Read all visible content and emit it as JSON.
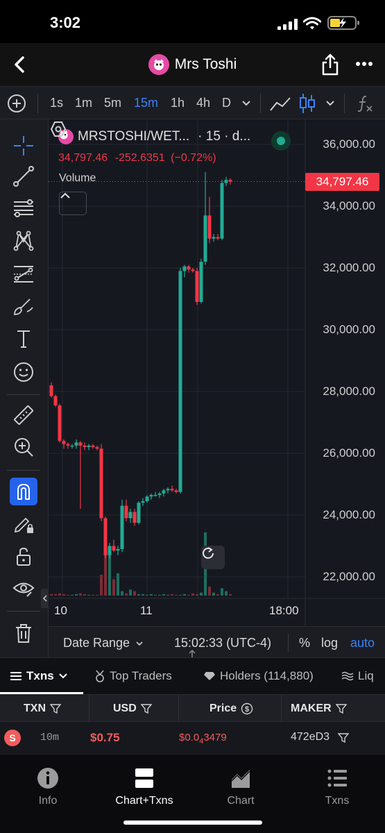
{
  "status_bar": {
    "time": "3:02"
  },
  "header": {
    "title": "Mrs Toshi"
  },
  "toolbar": {
    "timeframes": [
      {
        "label": "1s",
        "active": false
      },
      {
        "label": "1m",
        "active": false
      },
      {
        "label": "5m",
        "active": false
      },
      {
        "label": "15m",
        "active": true
      },
      {
        "label": "1h",
        "active": false
      },
      {
        "label": "4h",
        "active": false
      },
      {
        "label": "D",
        "active": false
      }
    ]
  },
  "legend": {
    "symbol": "MRSTOSHI/WET...",
    "interval": "· 15 · d...",
    "last": "34,797.46",
    "change": "-252.6351",
    "change_pct": "(−0.72%)",
    "volume_label": "Volume"
  },
  "chart_data": {
    "type": "candlestick",
    "y_range": [
      21000,
      36500
    ],
    "y_ticks": [
      "36,000.00",
      "34,000.00",
      "32,000.00",
      "30,000.00",
      "28,000.00",
      "26,000.00",
      "24,000.00",
      "22,000.00"
    ],
    "y_tick_values": [
      36000,
      34000,
      32000,
      30000,
      28000,
      26000,
      24000,
      22000
    ],
    "last_price": "34,797.46",
    "last_price_value": 34797.46,
    "x_ticks": [
      "10",
      "11",
      "18:00"
    ],
    "candles": [
      {
        "o": 28200,
        "h": 28300,
        "l": 27800,
        "c": 27850
      },
      {
        "o": 27850,
        "h": 27900,
        "l": 27500,
        "c": 27550
      },
      {
        "o": 27550,
        "h": 27600,
        "l": 26350,
        "c": 26400
      },
      {
        "o": 26400,
        "h": 26450,
        "l": 26150,
        "c": 26300
      },
      {
        "o": 26300,
        "h": 26350,
        "l": 26150,
        "c": 26250
      },
      {
        "o": 26250,
        "h": 26300,
        "l": 26150,
        "c": 26250
      },
      {
        "o": 26250,
        "h": 26450,
        "l": 26150,
        "c": 26350
      },
      {
        "o": 26350,
        "h": 26400,
        "l": 24200,
        "c": 26250
      },
      {
        "o": 26250,
        "h": 26350,
        "l": 26100,
        "c": 26200
      },
      {
        "o": 26200,
        "h": 26300,
        "l": 26100,
        "c": 26250
      },
      {
        "o": 26250,
        "h": 26300,
        "l": 26150,
        "c": 26200
      },
      {
        "o": 26200,
        "h": 26250,
        "l": 26100,
        "c": 26150
      },
      {
        "o": 26150,
        "h": 26300,
        "l": 23800,
        "c": 23900
      },
      {
        "o": 23900,
        "h": 23950,
        "l": 22600,
        "c": 22700
      },
      {
        "o": 22700,
        "h": 23100,
        "l": 22600,
        "c": 23000
      },
      {
        "o": 23000,
        "h": 23200,
        "l": 22800,
        "c": 22850
      },
      {
        "o": 22850,
        "h": 23000,
        "l": 22700,
        "c": 22900
      },
      {
        "o": 22900,
        "h": 24500,
        "l": 22800,
        "c": 24300
      },
      {
        "o": 24300,
        "h": 24500,
        "l": 23800,
        "c": 23900
      },
      {
        "o": 23900,
        "h": 24200,
        "l": 23750,
        "c": 24100
      },
      {
        "o": 24100,
        "h": 24200,
        "l": 23650,
        "c": 23750
      },
      {
        "o": 23750,
        "h": 24450,
        "l": 23700,
        "c": 24400
      },
      {
        "o": 24400,
        "h": 24550,
        "l": 24300,
        "c": 24450
      },
      {
        "o": 24450,
        "h": 24650,
        "l": 24400,
        "c": 24600
      },
      {
        "o": 24600,
        "h": 24700,
        "l": 24500,
        "c": 24650
      },
      {
        "o": 24650,
        "h": 24750,
        "l": 24600,
        "c": 24650
      },
      {
        "o": 24650,
        "h": 24750,
        "l": 24550,
        "c": 24700
      },
      {
        "o": 24700,
        "h": 24850,
        "l": 24600,
        "c": 24800
      },
      {
        "o": 24800,
        "h": 24900,
        "l": 24700,
        "c": 24850
      },
      {
        "o": 24850,
        "h": 24950,
        "l": 24750,
        "c": 24800
      },
      {
        "o": 24800,
        "h": 24850,
        "l": 24700,
        "c": 24750
      },
      {
        "o": 24750,
        "h": 32000,
        "l": 24700,
        "c": 31900
      },
      {
        "o": 31900,
        "h": 32100,
        "l": 31700,
        "c": 32050
      },
      {
        "o": 32050,
        "h": 32100,
        "l": 31850,
        "c": 31950
      },
      {
        "o": 31950,
        "h": 32000,
        "l": 31850,
        "c": 31900
      },
      {
        "o": 31900,
        "h": 32000,
        "l": 30800,
        "c": 30900
      },
      {
        "o": 30900,
        "h": 32300,
        "l": 30850,
        "c": 32200
      },
      {
        "o": 32200,
        "h": 35100,
        "l": 32100,
        "c": 33700
      },
      {
        "o": 33700,
        "h": 34300,
        "l": 32800,
        "c": 32950
      },
      {
        "o": 32950,
        "h": 33100,
        "l": 32850,
        "c": 33000
      },
      {
        "o": 33000,
        "h": 33100,
        "l": 32900,
        "c": 32950
      },
      {
        "o": 32950,
        "h": 34850,
        "l": 32900,
        "c": 34750
      },
      {
        "o": 34750,
        "h": 34950,
        "l": 34650,
        "c": 34850
      },
      {
        "o": 34850,
        "h": 34900,
        "l": 34700,
        "c": 34797
      }
    ],
    "volume": [
      2,
      2,
      3,
      2,
      1,
      1,
      2,
      3,
      2,
      1,
      1,
      1,
      28,
      55,
      65,
      22,
      30,
      6,
      3,
      8,
      6,
      2,
      2,
      1,
      2,
      1,
      1,
      2,
      1,
      2,
      1,
      1,
      2,
      1,
      3,
      2,
      4,
      85,
      12,
      4,
      2,
      10,
      6,
      2
    ],
    "volume_max": 140
  },
  "chart_footer": {
    "date_range": "Date Range",
    "time": "15:02:33 (UTC-4)",
    "percent": "%",
    "log": "log",
    "auto": "auto"
  },
  "tabs": [
    {
      "label": "Txns",
      "active": true
    },
    {
      "label": "Top Traders",
      "active": false
    },
    {
      "label": "Holders (114,880)",
      "active": false
    },
    {
      "label": "Liq",
      "active": false
    }
  ],
  "table": {
    "headers": [
      "TXN",
      "USD",
      "Price",
      "MAKER"
    ],
    "row": {
      "side": "S",
      "age": "10m",
      "usd": "$0.75",
      "price_prefix": "$0.0",
      "price_sub": "4",
      "price_rest": "3479",
      "maker": "472eD3"
    }
  },
  "bottom_nav": [
    {
      "label": "Info",
      "active": false
    },
    {
      "label": "Chart+Txns",
      "active": true
    },
    {
      "label": "Chart",
      "active": false
    },
    {
      "label": "Txns",
      "active": false
    }
  ],
  "colors": {
    "up": "#22ab94",
    "down": "#f23645",
    "accent": "#3b82f6",
    "chart_bg": "#161820"
  }
}
